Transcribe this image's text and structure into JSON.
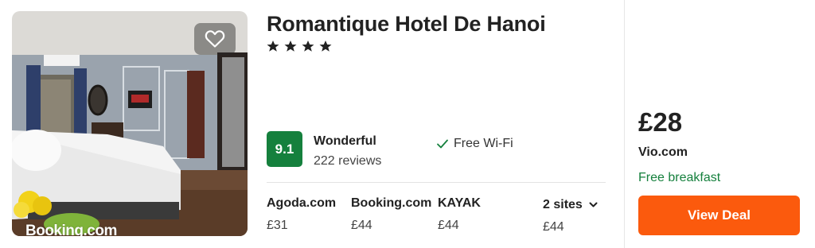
{
  "hotel": {
    "name": "Romantique Hotel De Hanoi",
    "stars": 4,
    "image_watermark": "Booking.com",
    "favorite_icon": "heart-outline-icon"
  },
  "rating": {
    "score": "9.1",
    "label": "Wonderful",
    "reviews": "222 reviews",
    "badge_color": "#15803d"
  },
  "amenities": [
    {
      "icon": "check-icon",
      "label": "Free Wi-Fi"
    }
  ],
  "sites": [
    {
      "name": "Agoda.com",
      "price": "£31"
    },
    {
      "name": "Booking.com",
      "price": "£44"
    },
    {
      "name": "KAYAK",
      "price": "£44"
    }
  ],
  "more_sites": {
    "label": "2 sites",
    "price": "£44",
    "icon": "chevron-down-icon"
  },
  "deal": {
    "price": "£28",
    "site": "Vio.com",
    "extra": "Free breakfast",
    "extra_color": "#15803d",
    "button_label": "View Deal",
    "button_color": "#fb5a0d"
  }
}
